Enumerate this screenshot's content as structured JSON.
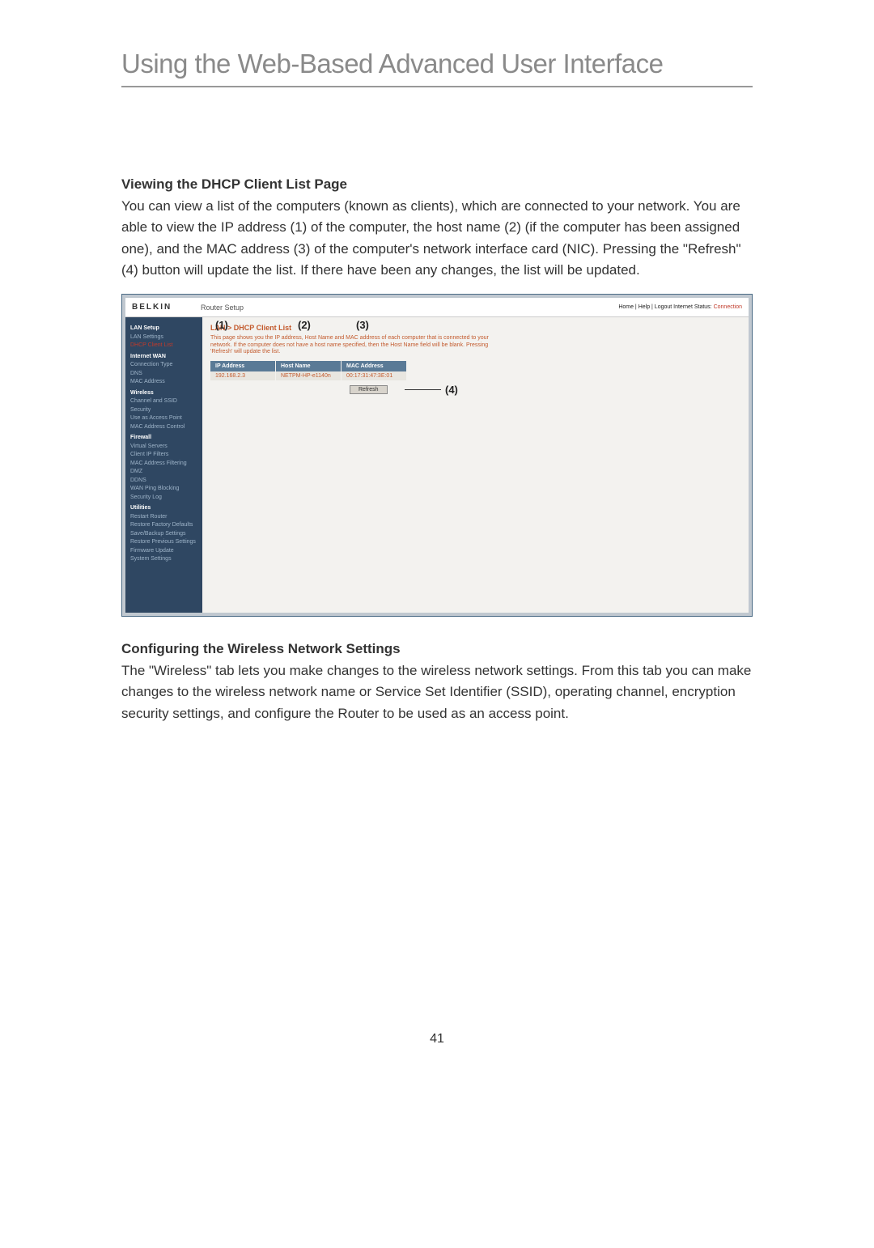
{
  "page": {
    "title": "Using the Web-Based Advanced User Interface",
    "number": "41"
  },
  "section1": {
    "heading": "Viewing the DHCP Client List Page",
    "body": "You can view a list of the computers (known as clients), which are connected to your network. You are able to view the IP address (1) of the computer, the host name (2) (if the computer has been assigned one), and the MAC address (3) of the computer's network interface card (NIC). Pressing the \"Refresh\" (4) button will update the list. If there have been any changes, the list will be updated."
  },
  "section2": {
    "heading": "Configuring the Wireless Network Settings",
    "body": "The \"Wireless\" tab lets you make changes to the wireless network settings. From this tab you can make changes to the wireless network name or Service Set Identifier (SSID), operating channel, encryption security settings, and configure the Router to be used as an access point."
  },
  "screenshot": {
    "brand": "BELKIN",
    "router_setup": "Router Setup",
    "topright": "Home | Help | Logout   Internet Status:",
    "topright_status": "Connection",
    "main_title": "LAN > DHCP Client List",
    "main_desc": "This page shows you the IP address, Host Name and MAC address of each computer that is connected to your network. If the computer does not have a host name specified, then the Host Name field will be blank. Pressing 'Refresh' will update the list.",
    "table": {
      "headers": {
        "ip": "IP Address",
        "host": "Host Name",
        "mac": "MAC Address"
      },
      "row": {
        "ip": "192.168.2.3",
        "host": "NETPM-HP-e1140n",
        "mac": "00:17:31:47:3E:01"
      }
    },
    "refresh": "Refresh",
    "sidebar": {
      "cat1": "LAN Setup",
      "i1": "LAN Settings",
      "i2": "DHCP Client List",
      "cat2": "Internet WAN",
      "i3": "Connection Type",
      "i4": "DNS",
      "i5": "MAC Address",
      "cat3": "Wireless",
      "i6": "Channel and SSID",
      "i7": "Security",
      "i8": "Use as Access Point",
      "i9": "MAC Address Control",
      "cat4": "Firewall",
      "i10": "Virtual Servers",
      "i11": "Client IP Filters",
      "i12": "MAC Address Filtering",
      "i13": "DMZ",
      "i14": "DDNS",
      "i15": "WAN Ping Blocking",
      "i16": "Security Log",
      "cat5": "Utilities",
      "i17": "Restart Router",
      "i18": "Restore Factory Defaults",
      "i19": "Save/Backup Settings",
      "i20": "Restore Previous Settings",
      "i21": "Firmware Update",
      "i22": "System Settings"
    },
    "callouts": {
      "c1": "(1)",
      "c2": "(2)",
      "c3": "(3)",
      "c4": "(4)"
    }
  }
}
